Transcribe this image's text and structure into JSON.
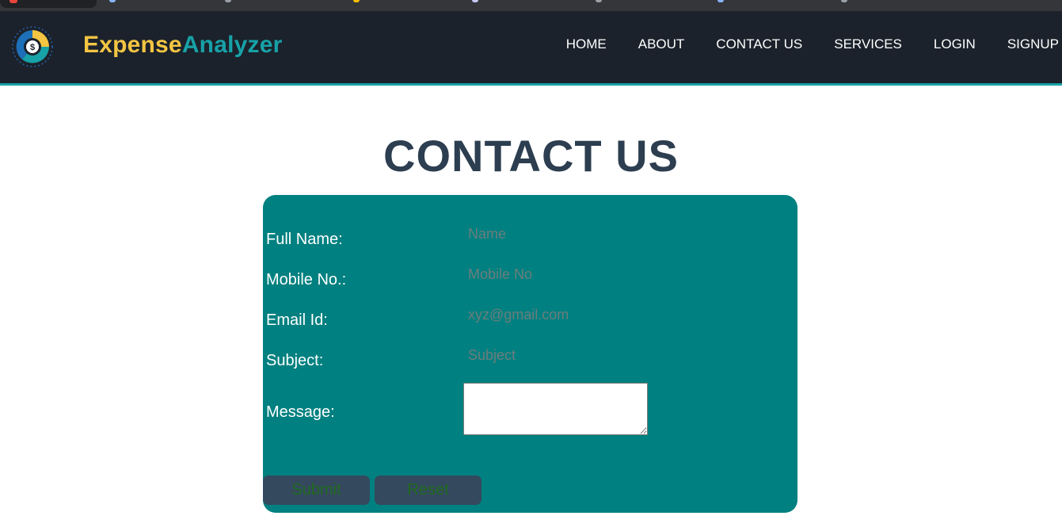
{
  "brand": {
    "part1": "Expense",
    "part2": "Analyzer"
  },
  "nav": {
    "items": [
      "HOME",
      "ABOUT",
      "CONTACT US",
      "SERVICES",
      "LOGIN",
      "SIGNUP"
    ]
  },
  "page": {
    "title": "CONTACT US"
  },
  "form": {
    "full_name": {
      "label": "Full Name:",
      "placeholder": "Name",
      "value": ""
    },
    "mobile": {
      "label": "Mobile No.:",
      "placeholder": "Mobile No",
      "value": ""
    },
    "email": {
      "label": "Email Id:",
      "placeholder": "xyz@gmail.com",
      "value": ""
    },
    "subject": {
      "label": "Subject:",
      "placeholder": "Subject",
      "value": ""
    },
    "message": {
      "label": "Message:",
      "value": ""
    },
    "submit_label": "Submit",
    "reset_label": "Reset"
  },
  "colors": {
    "navbar": "#1b222b",
    "accent_yellow": "#f4c542",
    "accent_teal": "#17a2a8",
    "card": "#008080",
    "title": "#2c3e50",
    "button": "#35495e"
  },
  "icons": {
    "logo": "dollar-pie-chart-icon"
  }
}
